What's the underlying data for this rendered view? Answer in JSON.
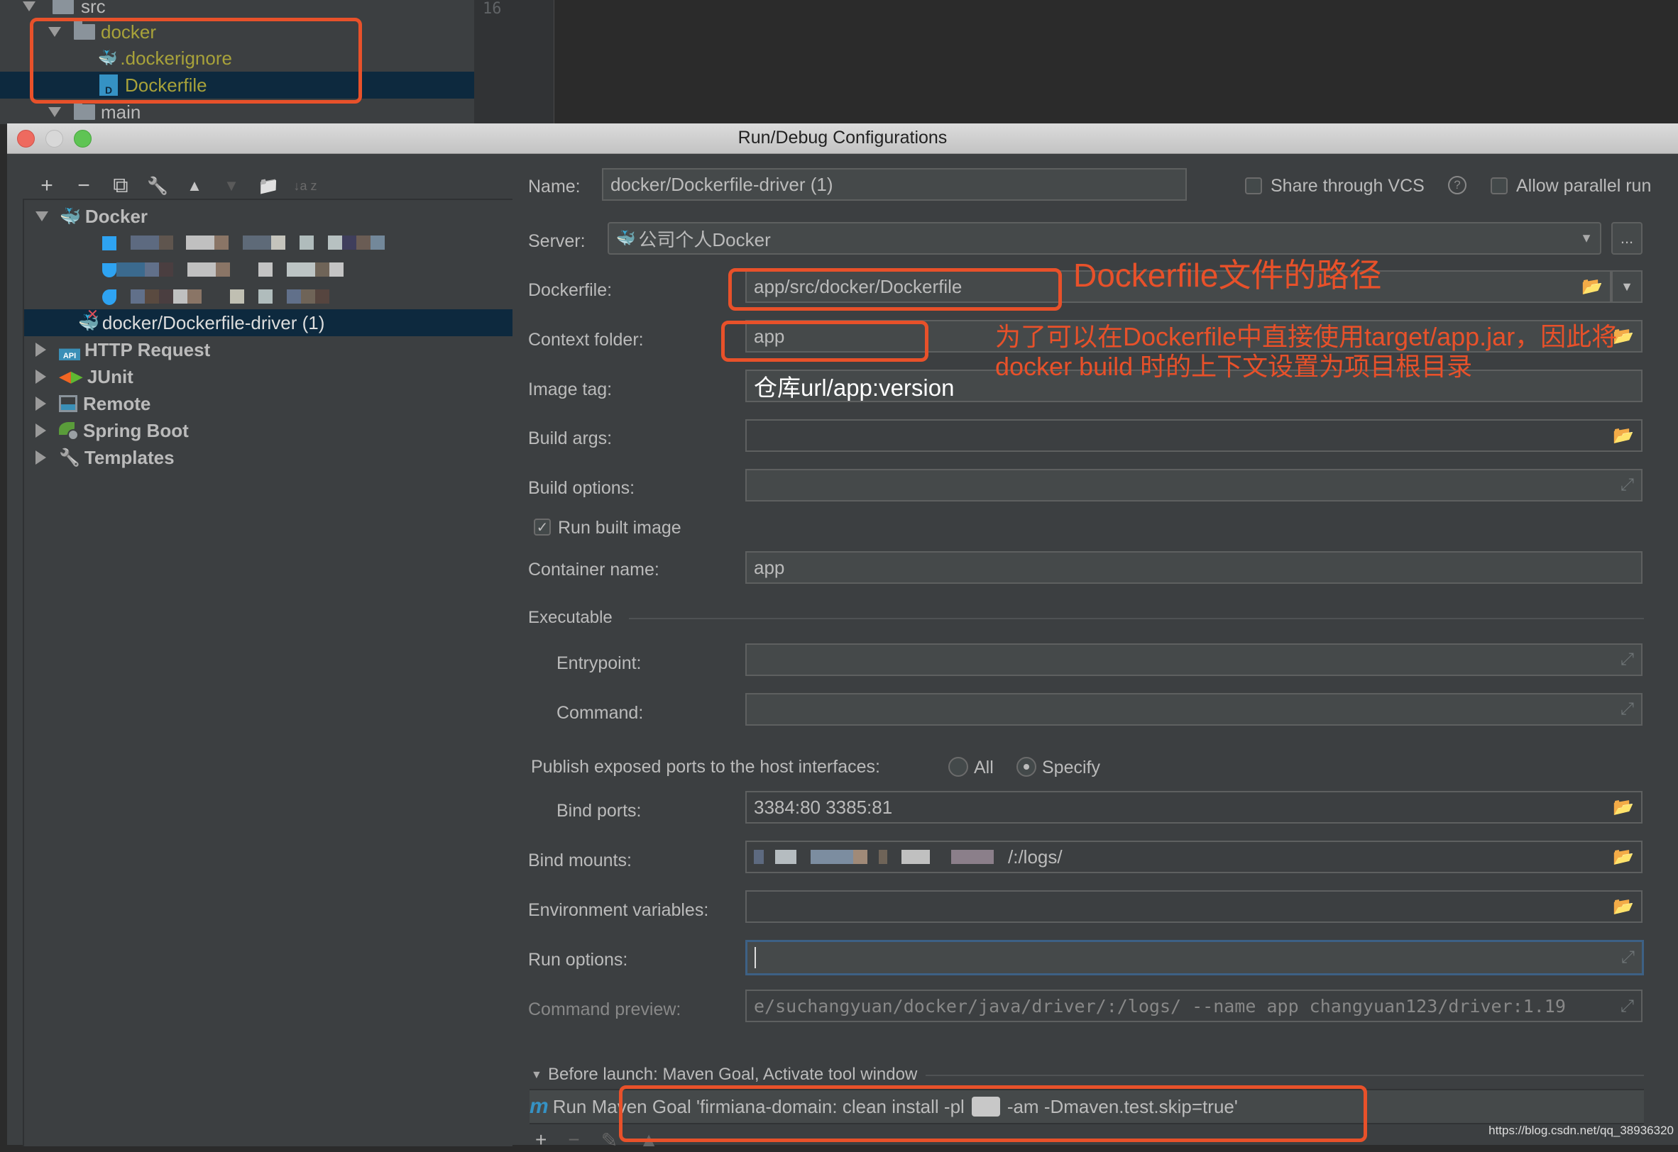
{
  "project_tree": {
    "items": [
      {
        "label": "src",
        "color": "#bbbbbb"
      },
      {
        "label": "docker",
        "color": "#a8a23a"
      },
      {
        "label": ".dockerignore",
        "color": "#a8a23a"
      },
      {
        "label": "Dockerfile",
        "color": "#a8a23a"
      },
      {
        "label": "main",
        "color": "#bbbbbb"
      }
    ],
    "line_number": "16"
  },
  "dialog": {
    "title": "Run/Debug Configurations",
    "toolbar": {
      "add": "+",
      "remove": "−",
      "copy": "⧉",
      "edit_defaults": "🔧",
      "move_up": "▲",
      "move_down": "▼",
      "new_folder": "📁",
      "sort": "↓a z"
    },
    "tree": {
      "docker_group": "Docker",
      "selected_item": "docker/Dockerfile-driver (1)",
      "groups": [
        "HTTP Request",
        "JUnit",
        "Remote",
        "Spring Boot",
        "Templates"
      ]
    },
    "form": {
      "name_label": "Name:",
      "name_value": "docker/Dockerfile-driver (1)",
      "share_vcs_label": "Share through VCS",
      "share_vcs_checked": false,
      "help_glyph": "?",
      "allow_parallel_label": "Allow parallel run",
      "allow_parallel_checked": false,
      "server_label": "Server:",
      "server_value": "公司个人Docker",
      "server_more": "...",
      "dockerfile_label": "Dockerfile:",
      "dockerfile_value": "app/src/docker/Dockerfile",
      "context_label": "Context folder:",
      "context_value": "app",
      "image_tag_label": "Image tag:",
      "image_tag_value": "仓库url/app:version",
      "build_args_label": "Build args:",
      "build_args_value": "",
      "build_options_label": "Build options:",
      "build_options_value": "",
      "run_built_image_label": "Run built image",
      "run_built_image_checked": true,
      "container_name_label": "Container name:",
      "container_name_value": "app",
      "executable_section": "Executable",
      "entrypoint_label": "Entrypoint:",
      "entrypoint_value": "",
      "command_label": "Command:",
      "command_value": "",
      "publish_label": "Publish exposed ports to the host interfaces:",
      "publish_all": "All",
      "publish_specify": "Specify",
      "publish_selected": "Specify",
      "bind_ports_label": "Bind ports:",
      "bind_ports_value": "3384:80 3385:81",
      "bind_mounts_label": "Bind mounts:",
      "bind_mounts_value_suffix": "/:/logs/",
      "env_label": "Environment variables:",
      "env_value": "",
      "run_options_label": "Run options:",
      "run_options_value": "",
      "command_preview_label": "Command preview:",
      "command_preview_value": "e/suchangyuan/docker/java/driver/:/logs/ --name app changyuan123/driver:1.19",
      "before_launch_label": "Before launch: Maven Goal, Activate tool window",
      "maven_goal_prefix": "Run Maven Goal 'firmiana-domain: clean install -pl",
      "maven_goal_suffix": "-am -Dmaven.test.skip=true'",
      "maven_icon": "m"
    }
  },
  "annotations": {
    "dockerfile_note": "Dockerfile文件的路径",
    "context_note_line1": "为了可以在Dockerfile中直接使用target/app.jar，因此将",
    "context_note_line2": "docker build 时的上下文设置为项目根目录",
    "color": "#e8512a"
  },
  "watermark": "https://blog.csdn.net/qq_38936320"
}
